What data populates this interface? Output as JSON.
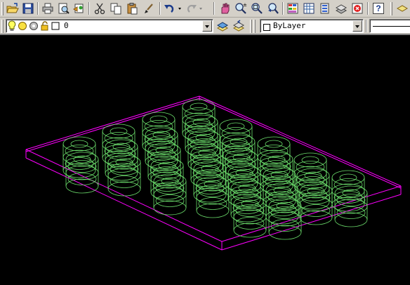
{
  "toolbar_standard": {
    "buttons": [
      {
        "name": "open-folder-button",
        "icon": "open-folder-icon"
      },
      {
        "name": "save-button",
        "icon": "save-icon"
      },
      {
        "name": "print-button",
        "icon": "printer-icon"
      },
      {
        "name": "print-preview-button",
        "icon": "print-preview-icon"
      },
      {
        "name": "publish-button",
        "icon": "publish-icon"
      },
      {
        "name": "cut-button",
        "icon": "scissors-icon"
      },
      {
        "name": "copy-button",
        "icon": "copy-icon"
      },
      {
        "name": "paste-button",
        "icon": "paste-icon"
      },
      {
        "name": "match-properties-button",
        "icon": "paintbrush-icon"
      },
      {
        "name": "undo-button",
        "icon": "undo-icon"
      },
      {
        "name": "redo-button",
        "icon": "redo-icon"
      },
      {
        "name": "pan-realtime-button",
        "icon": "pan-icon"
      },
      {
        "name": "zoom-realtime-button",
        "icon": "zoom-realtime-icon"
      },
      {
        "name": "zoom-window-button",
        "icon": "zoom-window-icon"
      },
      {
        "name": "zoom-previous-button",
        "icon": "zoom-previous-icon"
      },
      {
        "name": "properties-button",
        "icon": "properties-icon"
      },
      {
        "name": "design-center-button",
        "icon": "design-center-icon"
      },
      {
        "name": "tool-palettes-button",
        "icon": "tool-palettes-icon"
      },
      {
        "name": "sheet-set-button",
        "icon": "sheet-set-icon"
      },
      {
        "name": "markup-button",
        "icon": "markup-icon"
      },
      {
        "name": "help-button",
        "icon": "help-icon",
        "label": "?"
      }
    ]
  },
  "layers_toolbar": {
    "layer_name": "0",
    "state_icons": [
      "lightbulb-icon",
      "sun-icon",
      "freeze-icon",
      "lock-icon",
      "layer-color-swatch-icon"
    ],
    "make_current_icon": "layer-make-current-icon",
    "layer_previous_icon": "layer-previous-icon"
  },
  "properties_toolbar": {
    "color_value": "ByLayer",
    "linetype_value": ""
  },
  "drawing": {
    "background": "#000000",
    "plate_color": "#ff00ff",
    "cylinder_color": "#6bdc6b",
    "cylinder_rows": [
      {
        "row": 1,
        "count": 5
      },
      {
        "row": 2,
        "count": 6
      },
      {
        "row": 3,
        "count": 7
      },
      {
        "row": 4,
        "count": 8
      },
      {
        "row": 5,
        "count": 8
      }
    ]
  }
}
